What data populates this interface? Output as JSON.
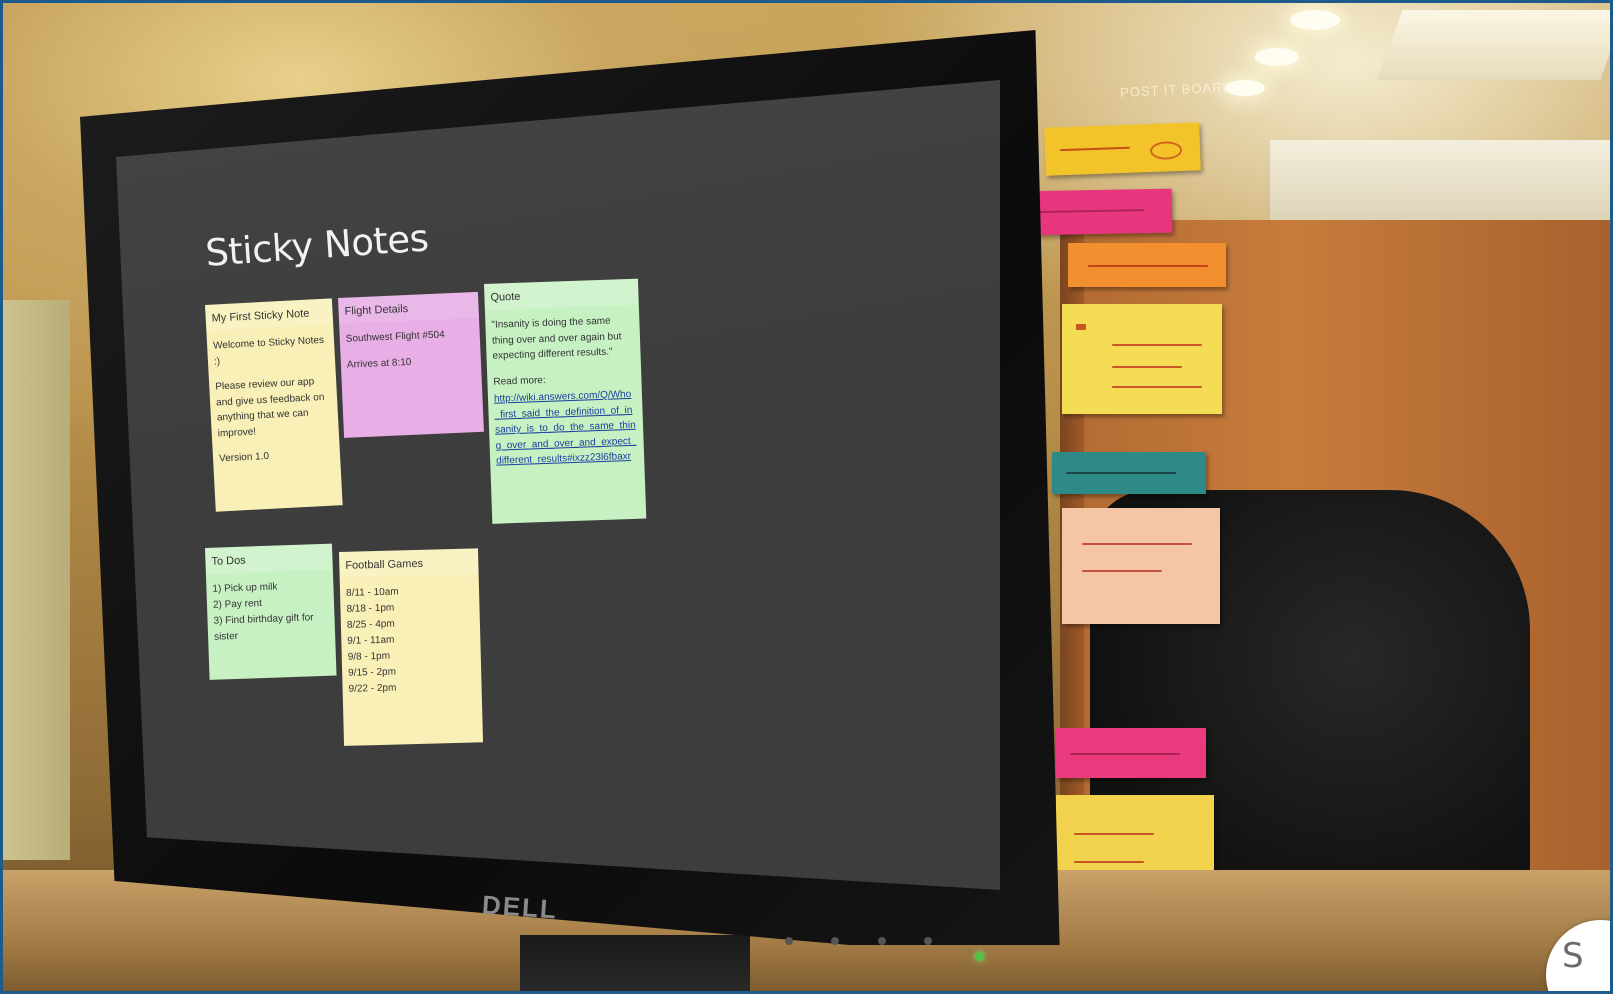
{
  "app": {
    "title": "Sticky Notes"
  },
  "notes": [
    {
      "color": "#f8f0b6",
      "title": "My First Sticky Note",
      "lines": [
        "Welcome to Sticky Notes :)",
        "Please review our app and give us feedback on anything that we can improve!",
        "Version 1.0"
      ]
    },
    {
      "color": "#e8aee6",
      "title": "Flight Details",
      "lines": [
        "Southwest Flight #504",
        "Arrives at 8:10"
      ]
    },
    {
      "color": "#c7f1c3",
      "title": "Quote",
      "lines": [
        "\"Insanity is doing the same thing over and over again but expecting different results.\"",
        "Read more:"
      ],
      "link": "http://wiki.answers.com/Q/Who_first_said_the_definition_of_insanity_is_to_do_the_same_thing_over_and_over_and_expect_different_results#ixzz23l6fbaxr"
    },
    {
      "color": "#c7f1c3",
      "title": "To Dos",
      "items": [
        "1) Pick up milk",
        "2) Pay rent",
        "3) Find birthday gift for sister"
      ]
    },
    {
      "color": "#f8f0b6",
      "title": "Football Games",
      "items": [
        "8/11 - 10am",
        "8/18 - 1pm",
        "8/25 - 4pm",
        "9/1 - 11am",
        "9/8 - 1pm",
        "9/15 - 2pm",
        "9/22 - 2pm"
      ]
    }
  ],
  "monitor": {
    "brand": "DELL"
  },
  "corner_badge": {
    "letter": "S"
  }
}
